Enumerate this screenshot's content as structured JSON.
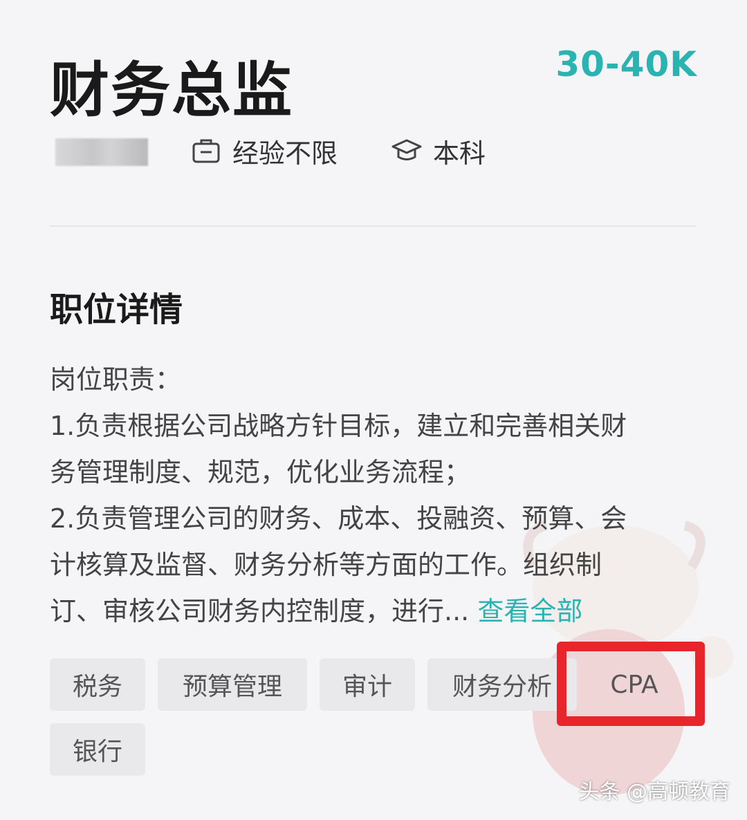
{
  "job": {
    "title": "财务总监",
    "salary": "30-40K",
    "experience": "经验不限",
    "education": "本科"
  },
  "icons": {
    "experience": "briefcase-icon",
    "education": "graduation-cap-icon"
  },
  "colors": {
    "accent": "#2bb3b1",
    "highlight": "#e8252b"
  },
  "section": {
    "title": "职位详情"
  },
  "description": {
    "lines": [
      "岗位职责：",
      "1.负责根据公司战略方针目标，建立和完善相关财",
      "务管理制度、规范，优化业务流程；",
      "2.负责管理公司的财务、成本、投融资、预算、会",
      "计核算及监督、财务分析等方面的工作。组织制",
      "订、审核公司财务内控制度，进行..."
    ],
    "view_all": "查看全部"
  },
  "tags": [
    "税务",
    "预算管理",
    "审计",
    "财务分析",
    "CPA",
    "银行"
  ],
  "watermark": "头条 @高顿教育"
}
